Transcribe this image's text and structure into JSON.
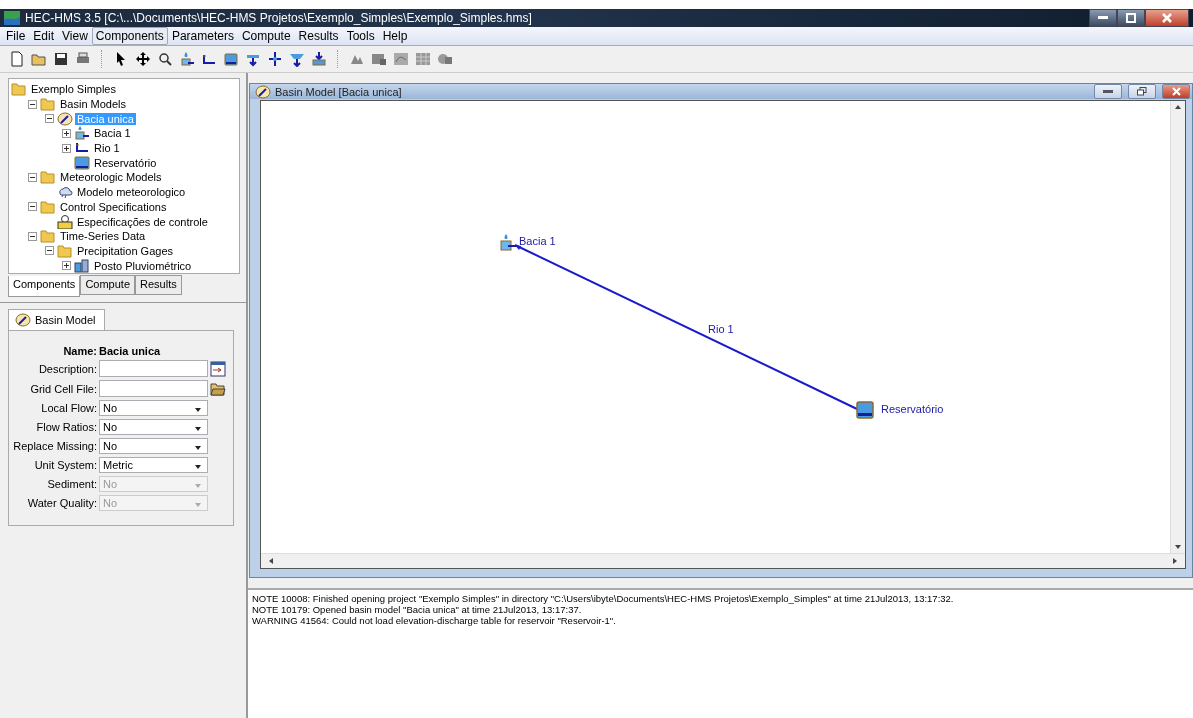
{
  "window": {
    "title": "HEC-HMS 3.5 [C:\\...\\Documents\\HEC-HMS Projetos\\Exemplo_Simples\\Exemplo_Simples.hms]"
  },
  "menu": [
    {
      "label": "File",
      "selected": false
    },
    {
      "label": "Edit",
      "selected": false
    },
    {
      "label": "View",
      "selected": false
    },
    {
      "label": "Components",
      "selected": true
    },
    {
      "label": "Parameters",
      "selected": false
    },
    {
      "label": "Compute",
      "selected": false
    },
    {
      "label": "Results",
      "selected": false
    },
    {
      "label": "Tools",
      "selected": false
    },
    {
      "label": "Help",
      "selected": false
    }
  ],
  "toolbar": [
    [
      {
        "kind": "new"
      },
      {
        "kind": "open"
      },
      {
        "kind": "save"
      },
      {
        "kind": "print"
      }
    ],
    [
      {
        "kind": "pointer"
      },
      {
        "kind": "pan"
      },
      {
        "kind": "zoom"
      },
      {
        "kind": "subbasin"
      },
      {
        "kind": "reach"
      },
      {
        "kind": "reservoir"
      },
      {
        "kind": "junction"
      },
      {
        "kind": "diversion"
      },
      {
        "kind": "source"
      },
      {
        "kind": "sink"
      }
    ],
    [
      {
        "kind": "compute"
      },
      {
        "kind": "summary"
      },
      {
        "kind": "graph"
      },
      {
        "kind": "table"
      },
      {
        "kind": "timeseries"
      }
    ]
  ],
  "tree": {
    "label": "Exemplo Simples",
    "kind": "folder",
    "selected": false,
    "children": [
      {
        "label": "Basin Models",
        "kind": "folder",
        "expanded": true,
        "selected": false,
        "children": [
          {
            "label": "Bacia unica",
            "kind": "basin",
            "expanded": true,
            "selected": true,
            "children": [
              {
                "label": "Bacia 1",
                "kind": "subbasin",
                "expanded": false,
                "selected": false
              },
              {
                "label": "Rio 1",
                "kind": "reach",
                "expanded": false,
                "selected": false
              },
              {
                "label": "Reservatório",
                "kind": "reservoir",
                "selected": false
              }
            ]
          }
        ]
      },
      {
        "label": "Meteorologic Models",
        "kind": "folder",
        "expanded": true,
        "selected": false,
        "children": [
          {
            "label": "Modelo meteorologico",
            "kind": "met",
            "selected": false
          }
        ]
      },
      {
        "label": "Control Specifications",
        "kind": "folder",
        "expanded": true,
        "selected": false,
        "children": [
          {
            "label": "Especificações de controle",
            "kind": "control",
            "selected": false
          }
        ]
      },
      {
        "label": "Time-Series Data",
        "kind": "folder",
        "expanded": true,
        "selected": false,
        "children": [
          {
            "label": "Precipitation Gages",
            "kind": "folder",
            "expanded": true,
            "selected": false,
            "children": [
              {
                "label": "Posto Pluviométrico",
                "kind": "gage",
                "expanded": false,
                "selected": false
              }
            ]
          }
        ]
      }
    ]
  },
  "panel_tabs": [
    {
      "label": "Components",
      "selected": true
    },
    {
      "label": "Compute",
      "selected": false
    },
    {
      "label": "Results",
      "selected": false
    }
  ],
  "editor": {
    "tab": "Basin Model",
    "name_label": "Name:",
    "name_value": "Bacia unica",
    "fields": [
      {
        "label": "Description:",
        "kind": "text",
        "button": {
          "kind": "notes"
        }
      },
      {
        "label": "Grid Cell File:",
        "kind": "text",
        "button": {
          "kind": "browse"
        }
      },
      {
        "label": "Local Flow:",
        "kind": "dropdown",
        "value": "No",
        "disabled": false
      },
      {
        "label": "Flow Ratios:",
        "kind": "dropdown",
        "value": "No",
        "disabled": false
      },
      {
        "label": "Replace Missing:",
        "kind": "dropdown",
        "value": "No",
        "disabled": false
      },
      {
        "label": "Unit System:",
        "kind": "dropdown",
        "value": "Metric",
        "disabled": false
      },
      {
        "label": "Sediment:",
        "kind": "dropdown",
        "value": "No",
        "disabled": true
      },
      {
        "label": "Water Quality:",
        "kind": "dropdown",
        "value": "No",
        "disabled": true
      }
    ]
  },
  "basin_window": {
    "title": "Basin Model [Bacia unica]",
    "elements": [
      {
        "kind": "subbasin",
        "label": "Bacia 1"
      },
      {
        "kind": "reach",
        "label": "Rio 1"
      },
      {
        "kind": "reservoir",
        "label": "Reservatório"
      }
    ]
  },
  "messages": [
    "NOTE 10008:  Finished opening project \"Exemplo Simples\" in directory \"C:\\Users\\ibyte\\Documents\\HEC-HMS Projetos\\Exemplo_Simples\" at time 21Jul2013, 13:17:32.",
    "NOTE 10179:  Opened basin model \"Bacia unica\" at time 21Jul2013, 13:17:37.",
    "WARNING 41564:  Could not load elevation-discharge table for reservoir \"Reservoir-1\"."
  ]
}
